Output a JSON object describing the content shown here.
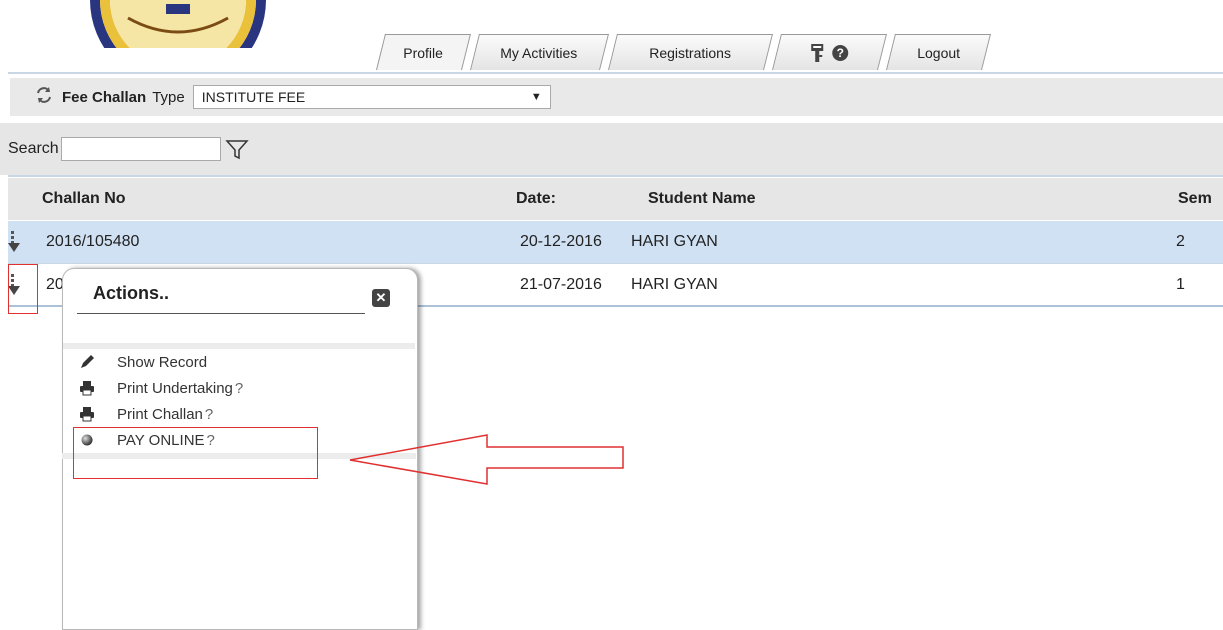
{
  "tabs": [
    {
      "label": "Profile"
    },
    {
      "label": "My Activities"
    },
    {
      "label": "Registrations"
    },
    {
      "label": "Logout"
    }
  ],
  "icons": {
    "tools": "key-icon",
    "help": "help-icon",
    "help_glyph": "?",
    "close_glyph": "✕"
  },
  "fee_challan": {
    "title": "Fee Challan",
    "type_label": "Type",
    "type_value": "INSTITUTE FEE",
    "arrow": "▼"
  },
  "search": {
    "label": "Search",
    "value": ""
  },
  "table": {
    "headers": [
      "Challan No",
      "Date:",
      "Student Name",
      "Sem"
    ],
    "rows": [
      {
        "challan": "2016/105480",
        "date": "20-12-2016",
        "name": "HARI GYAN",
        "sem": "2"
      },
      {
        "challan": "20",
        "date": "21-07-2016",
        "name": "HARI GYAN",
        "sem": "1"
      }
    ]
  },
  "popup": {
    "title": "Actions..",
    "items": [
      {
        "label": "Show Record",
        "suffix": ""
      },
      {
        "label": "Print Undertaking",
        "suffix": "?"
      },
      {
        "label": "Print Challan",
        "suffix": "?"
      },
      {
        "label": "PAY ONLINE",
        "suffix": "?"
      }
    ]
  },
  "colors": {
    "selected_row": "#cfe1f3",
    "annotation": "#e03030"
  }
}
